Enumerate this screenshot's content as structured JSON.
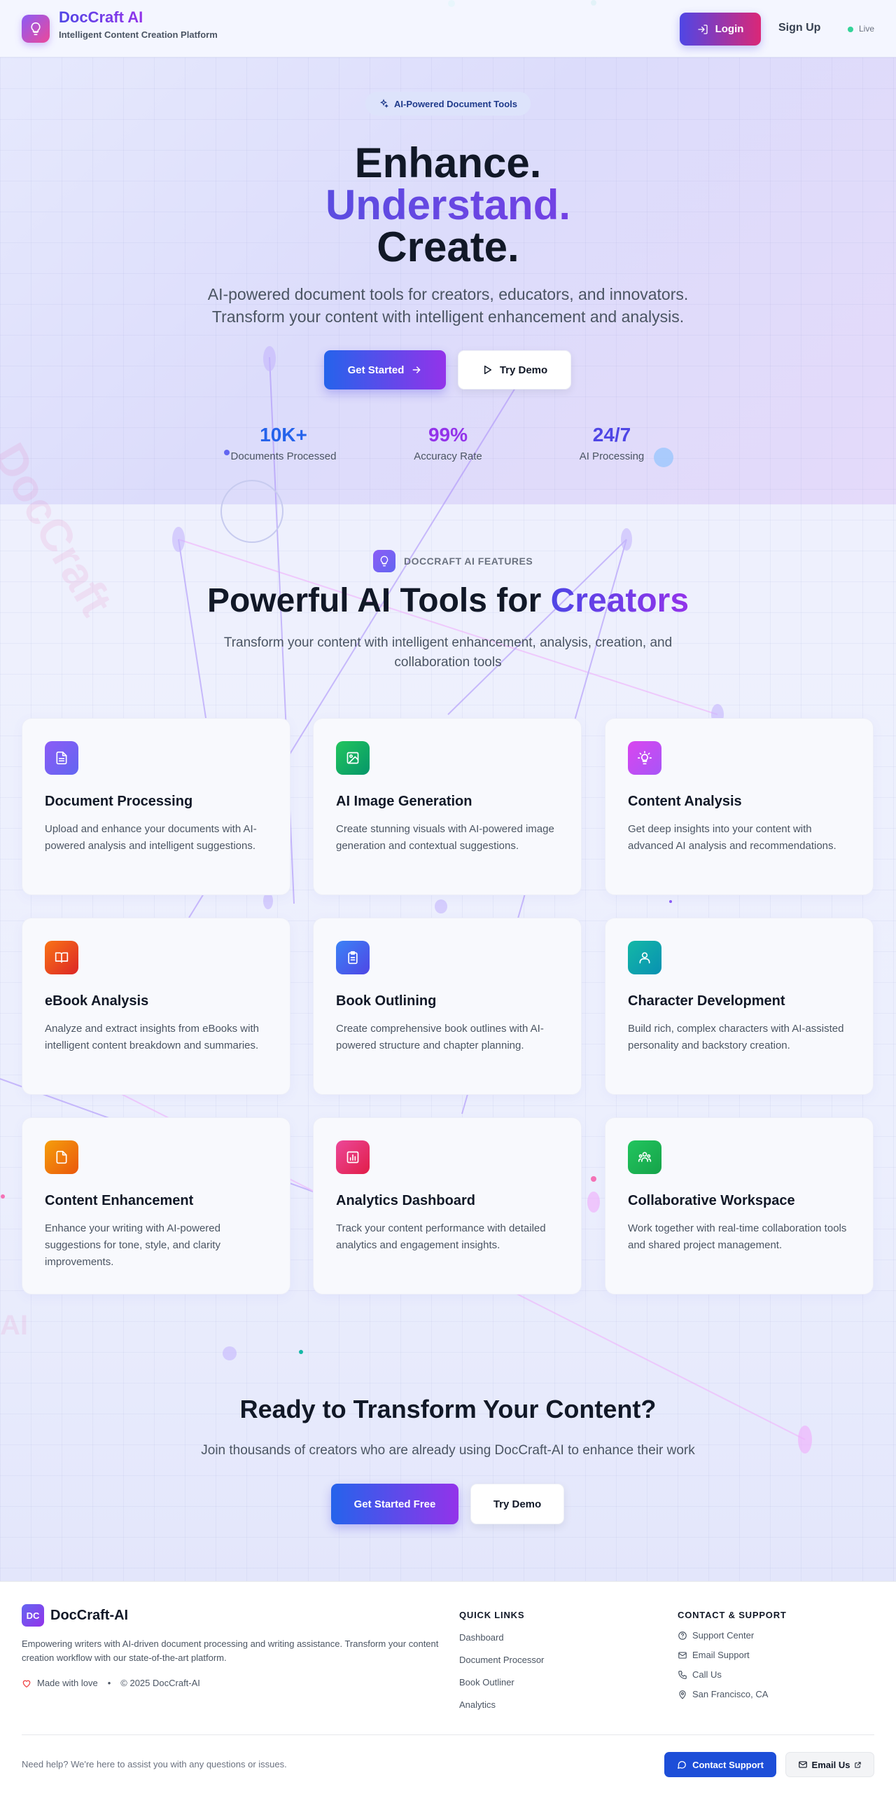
{
  "header": {
    "brand": "DocCraft AI",
    "tagline": "Intelligent Content Creation Platform",
    "login_label": "Login",
    "signup_label": "Sign Up",
    "live_label": "Live"
  },
  "hero": {
    "pill_label": "AI-Powered Document Tools",
    "headline_1": "Enhance.",
    "headline_2": "Understand.",
    "headline_3": "Create.",
    "subtitle_1": "AI-powered document tools for creators, educators, and innovators.",
    "subtitle_2": "Transform your content with intelligent enhancement and analysis.",
    "primary_label": "Get Started",
    "secondary_label": "Try Demo",
    "stats": [
      {
        "value": "10K+",
        "label": "Documents Processed",
        "color": "#2563eb"
      },
      {
        "value": "99%",
        "label": "Accuracy Rate",
        "color": "#9333ea"
      },
      {
        "value": "24/7",
        "label": "AI Processing",
        "color": "#4f46e5"
      }
    ]
  },
  "background": {
    "watermark_1": "DocCraft",
    "watermark_2": "AI"
  },
  "features": {
    "kicker": "DOCCRAFT AI FEATURES",
    "title_main": "Powerful AI Tools for ",
    "title_accent": "Creators",
    "subtitle": "Transform your content with intelligent enhancement, analysis, creation, and collaboration tools",
    "cards": [
      {
        "title": "Document Processing",
        "desc": "Upload and enhance your documents with AI-powered analysis and intelligent suggestions.",
        "icon": "document-icon",
        "color_a": "#8b5cf6",
        "color_b": "#6366f1"
      },
      {
        "title": "AI Image Generation",
        "desc": "Create stunning visuals with AI-powered image generation and contextual suggestions.",
        "icon": "image-icon",
        "color_a": "#22c55e",
        "color_b": "#059669"
      },
      {
        "title": "Content Analysis",
        "desc": "Get deep insights into your content with advanced AI analysis and recommendations.",
        "icon": "lightbulb-icon",
        "color_a": "#d946ef",
        "color_b": "#a855f7"
      },
      {
        "title": "eBook Analysis",
        "desc": "Analyze and extract insights from eBooks with intelligent content breakdown and summaries.",
        "icon": "book-open-icon",
        "color_a": "#f97316",
        "color_b": "#dc2626"
      },
      {
        "title": "Book Outlining",
        "desc": "Create comprehensive book outlines with AI-powered structure and chapter planning.",
        "icon": "clipboard-icon",
        "color_a": "#3b82f6",
        "color_b": "#4f46e5"
      },
      {
        "title": "Character Development",
        "desc": "Build rich, complex characters with AI-assisted personality and backstory creation.",
        "icon": "user-icon",
        "color_a": "#14b8a6",
        "color_b": "#0891b2"
      },
      {
        "title": "Content Enhancement",
        "desc": "Enhance your writing with AI-powered suggestions for tone, style, and clarity improvements.",
        "icon": "file-icon",
        "color_a": "#f59e0b",
        "color_b": "#ea580c"
      },
      {
        "title": "Analytics Dashboard",
        "desc": "Track your content performance with detailed analytics and engagement insights.",
        "icon": "bar-chart-icon",
        "color_a": "#ec4899",
        "color_b": "#e11d48"
      },
      {
        "title": "Collaborative Workspace",
        "desc": "Work together with real-time collaboration tools and shared project management.",
        "icon": "users-icon",
        "color_a": "#22c55e",
        "color_b": "#16a34a"
      }
    ]
  },
  "cta": {
    "title": "Ready to Transform Your Content?",
    "subtitle": "Join thousands of creators who are already using DocCraft-AI to enhance their work",
    "primary_label": "Get Started Free",
    "secondary_label": "Try Demo"
  },
  "footer": {
    "logo_text": "DC",
    "brand": "DocCraft-AI",
    "description": "Empowering writers with AI-driven document processing and writing assistance. Transform your content creation workflow with our state-of-the-art platform.",
    "made_with": "Made with love",
    "copyright": "© 2025 DocCraft-AI",
    "quick_links_title": "QUICK LINKS",
    "quick_links": [
      "Dashboard",
      "Document Processor",
      "Book Outliner",
      "Analytics"
    ],
    "contact_title": "CONTACT & SUPPORT",
    "contact_links": [
      "Support Center",
      "Email Support",
      "Call Us",
      "San Francisco, CA"
    ],
    "help_text": "Need help? We're here to assist you with any questions or issues.",
    "contact_button": "Contact Support",
    "email_button": "Email Us"
  }
}
